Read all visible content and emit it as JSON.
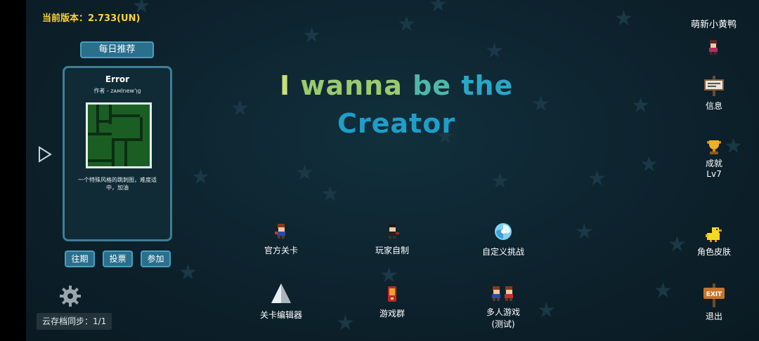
{
  "header": {
    "version_label": "当前版本：2.733(UN)",
    "username": "萌新小黄鸭"
  },
  "daily": {
    "tab_label": "每日推荐",
    "level_title": "Error",
    "author": "作者 - ᴢᴀᴍlnew'ᴉg",
    "description": "一个特殊风格的跳刺图，难度适中，加油",
    "buttons": [
      "往期",
      "投票",
      "参加"
    ]
  },
  "title": {
    "line1_words": [
      "I",
      "wanna",
      "be",
      "the"
    ],
    "line2": "Creator",
    "colors": {
      "I": "#c8e07a",
      "wanna": "#9acb6e",
      "be": "#4fb7a8",
      "the": "#2aa6c6",
      "Creator": "#1e9ec8"
    }
  },
  "menu": {
    "official": "官方关卡",
    "player_made": "玩家自制",
    "custom_challenge": "自定义挑战",
    "editor": "关卡编辑器",
    "group": "游戏群",
    "multiplayer_line1": "多人游戏",
    "multiplayer_line2": "(测试)"
  },
  "right_menu": {
    "info": "信息",
    "achievements": "成就",
    "achievement_level": "Lv7",
    "skins": "角色皮肤",
    "exit": "退出",
    "exit_sign": "EXIT"
  },
  "footer": {
    "settings": "设置",
    "cloud_sync": "云存档同步：1/1"
  },
  "icons": {
    "play": "play-arrow-icon",
    "settings": "gear-icon"
  },
  "colors": {
    "version_text": "#ffd23a",
    "button_fill": "#2a6f8c",
    "button_border": "#47a0c0",
    "background": "#0b1d26"
  }
}
